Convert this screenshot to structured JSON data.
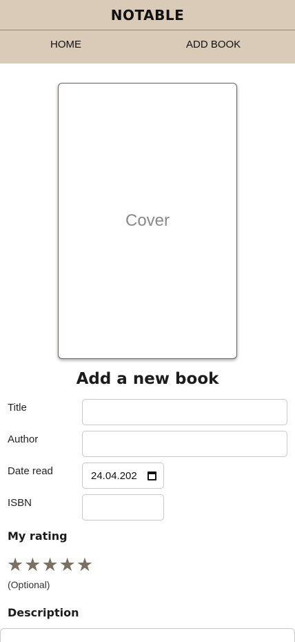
{
  "header": {
    "app_title": "NOTABLE"
  },
  "nav": {
    "home": "HOME",
    "add_book": "ADD BOOK"
  },
  "cover": {
    "placeholder": "Cover"
  },
  "form": {
    "title": "Add a new book",
    "title_label": "Title",
    "author_label": "Author",
    "date_read_label": "Date read",
    "date_read_value": "24.04.202",
    "isbn_label": "ISBN",
    "rating_label": "My rating",
    "rating_value": 5,
    "rating_max": 5,
    "optional_note": "(Optional)",
    "description_label": "Description"
  },
  "icons": {
    "star": "star-icon",
    "calendar": "calendar-icon"
  },
  "colors": {
    "header_bg": "#d9cbb8",
    "star": "#7b7163"
  }
}
